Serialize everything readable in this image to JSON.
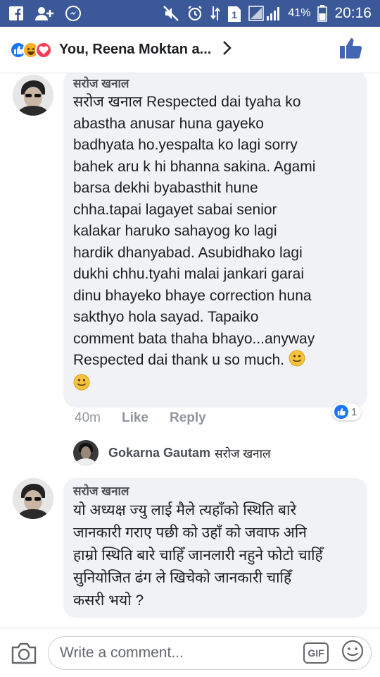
{
  "status_bar": {
    "battery_pct": "41%",
    "time": "20:16",
    "icons": [
      "facebook-icon",
      "add-friend-icon",
      "messenger-icon",
      "mute-icon",
      "alarm-icon",
      "data-icon",
      "sim-1-icon",
      "signal-icon",
      "battery-icon"
    ]
  },
  "header": {
    "reaction_icons": [
      "like-reaction-icon",
      "haha-reaction-icon",
      "love-reaction-icon"
    ],
    "title": "You, Reena Moktan a...",
    "like_icon": "thumbs-up-icon"
  },
  "comments": [
    {
      "author": "सरोज खनाल",
      "lines": [
        "सरोज खनाल Respected dai tyaha ko",
        "abastha anusar huna gayeko",
        "badhyata ho.yespalta ko lagi sorry",
        "bahek aru k hi bhanna sakina. Agami",
        "barsa dekhi byabasthit hune",
        "chha.tapai lagayet sabai senior",
        "kalakar haruko sahayog ko lagi",
        "hardik dhanyabad. Asubidhako lagi",
        "dukhi chhu.tyahi malai jankari garai",
        "dinu bhayeko bhaye correction huna",
        "sakthyo hola sayad. Tapaiko",
        "comment bata thaha bhayo...anyway",
        "Respected dai thank u so much."
      ],
      "time": "40m",
      "like_label": "Like",
      "reply_label": "Reply",
      "reaction_count": "1"
    },
    {
      "author": "सरोज खनाल",
      "lines": [
        "यो अध्यक्ष ज्यु लाई मैले त्यहाँको स्थिति बारे",
        "जानकारी गराए पछी को उहाँ को जवाफ अनि",
        "हाम्रो स्थिति बारे चाहिँ जानलारी नहुने फोटो चाहिँ",
        "सुनियोजित ढंग ले खिचेको जानकारी चाहिँ",
        "कसरी भयो ?"
      ]
    }
  ],
  "reply_preview": {
    "name": "Gokarna Gautam",
    "target": "सरोज खनाल"
  },
  "composer": {
    "placeholder": "Write a comment...",
    "gif_label": "GIF"
  }
}
